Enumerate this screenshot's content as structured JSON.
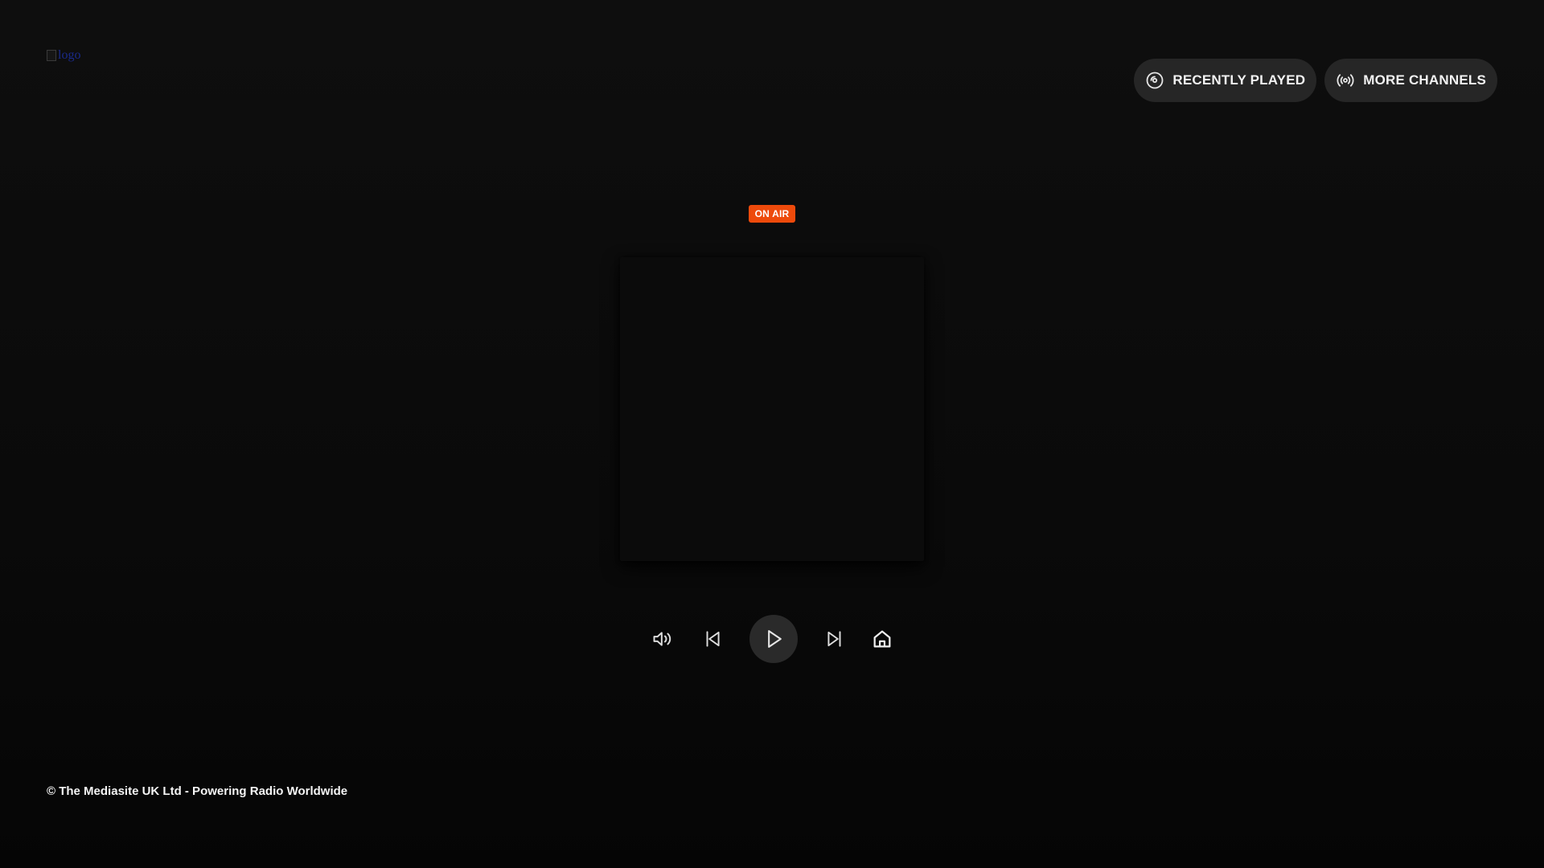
{
  "header": {
    "logo_alt": "logo"
  },
  "nav": {
    "recently_played_label": "RECENTLY PLAYED",
    "more_channels_label": "MORE CHANNELS"
  },
  "player": {
    "status_badge": "ON AIR"
  },
  "controls": {
    "volume_icon": "volume-icon",
    "previous_icon": "skip-back-icon",
    "play_icon": "play-icon",
    "next_icon": "skip-forward-icon",
    "home_icon": "home-icon"
  },
  "footer": {
    "copyright": "© The Mediasite UK Ltd - Powering Radio Worldwide"
  },
  "colors": {
    "background": "#0a0a0a",
    "pill_background": "#262626",
    "on_air": "#ee4a0b",
    "text": "#ffffff"
  }
}
